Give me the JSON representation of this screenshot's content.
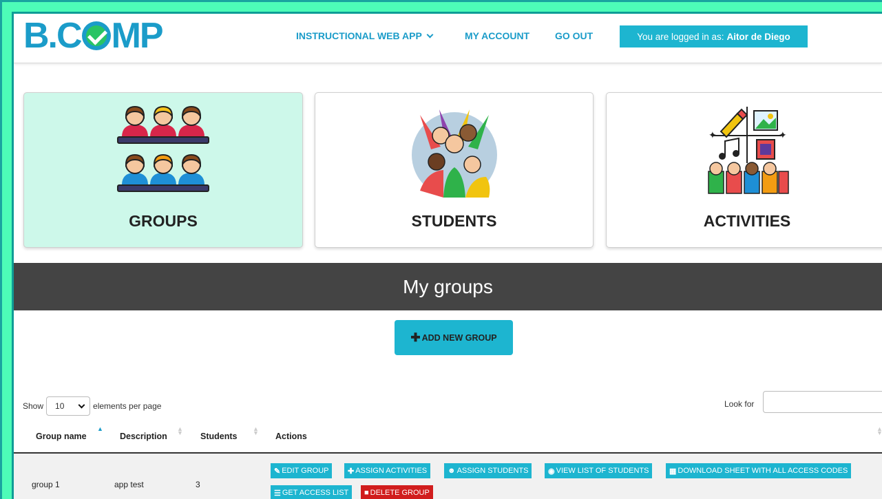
{
  "header": {
    "logo": "B.COMP",
    "nav": {
      "instructional": "INSTRUCTIONAL WEB APP",
      "account": "MY ACCOUNT",
      "go_out": "GO OUT"
    },
    "logged_prefix": "You are logged in as:",
    "user_name": "Aitor de Diego"
  },
  "cards": {
    "groups": "GROUPS",
    "students": "STUDENTS",
    "activities": "ACTIVITIES"
  },
  "section_title": "My groups",
  "add_button": "ADD NEW GROUP",
  "table_controls": {
    "show_label": "Show",
    "page_size": "10",
    "per_page_label": "elements per page",
    "look_for_label": "Look for",
    "search_value": ""
  },
  "table": {
    "columns": [
      "Group name",
      "Description",
      "Students",
      "Actions"
    ],
    "rows": [
      {
        "name": "group 1",
        "description": "app test",
        "students": "3",
        "actions": [
          "EDIT GROUP",
          "ASSIGN ACTIVITIES",
          "ASSIGN STUDENTS",
          "VIEW LIST OF STUDENTS",
          "DOWNLOAD SHEET WITH ALL ACCESS CODES",
          "GET ACCESS LIST",
          "DELETE GROUP"
        ]
      }
    ]
  },
  "colors": {
    "accent": "#1db5d0",
    "logo": "#1b9cc9",
    "danger": "#d11d1d",
    "active_card": "#cdf8ea",
    "band": "#444444",
    "frame": "#4dfcb8"
  }
}
